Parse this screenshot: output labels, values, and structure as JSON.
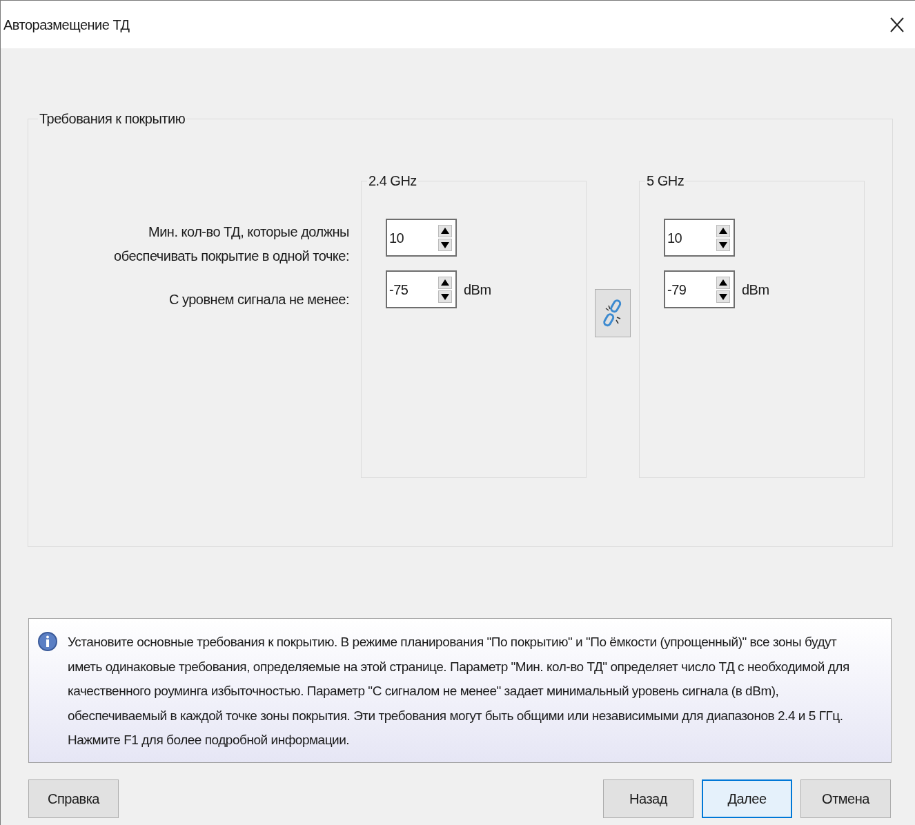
{
  "window": {
    "title": "Авторазмещение ТД"
  },
  "coverage": {
    "title": "Требования к покрытию",
    "labels": [
      "Мин. кол-во ТД, которые должны\nобеспечивать покрытие в одной точке:",
      "С уровнем сигнала не менее:"
    ],
    "bands": [
      {
        "title": "2.4 GHz",
        "fields": [
          {
            "value": "10"
          },
          {
            "value": "-75",
            "unit": "dBm"
          }
        ]
      },
      {
        "title": "5 GHz",
        "fields": [
          {
            "value": "10"
          },
          {
            "value": "-79",
            "unit": "dBm"
          }
        ]
      }
    ],
    "link_linked": false
  },
  "info": "Установите основные требования к покрытию. В режиме планирования \"По покрытию\" и \"По ёмкости (упрощенный)\" все зоны будут иметь одинаковые требования, определяемые на этой странице. Параметр \"Мин. кол-во ТД\" определяет число ТД с необходимой для качественного роуминга избыточностью. Параметр \"С сигналом не менее\" задает минимальный уровень сигнала (в dBm), обеспечиваемый в каждой точке зоны покрытия. Эти требования могут быть общими или независимыми для диапазонов 2.4 и 5 ГГц. Нажмите F1 для более подробной информации.",
  "buttons": [
    {
      "label": "Справка",
      "default": false
    },
    {
      "label": "Назад",
      "default": false
    },
    {
      "label": "Далее",
      "default": true
    },
    {
      "label": "Отмена",
      "default": false
    }
  ]
}
